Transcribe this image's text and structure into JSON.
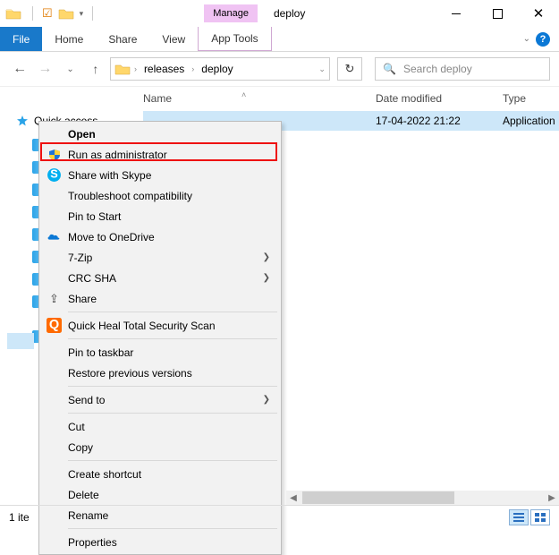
{
  "window": {
    "context_tab": "Manage",
    "title": "deploy",
    "controls": {
      "close": "✕"
    }
  },
  "tabs": {
    "file": "File",
    "home": "Home",
    "share": "Share",
    "view": "View",
    "apptools": "App Tools"
  },
  "help": {
    "caret": "⌄",
    "q": "?"
  },
  "nav": {
    "back": "←",
    "forward": "→",
    "up": "↑",
    "recent_caret": "⌄",
    "refresh": "↻"
  },
  "breadcrumb": {
    "seg1": "releases",
    "seg2": "deploy",
    "sep": "›"
  },
  "search": {
    "placeholder": "Search deploy",
    "icon": "🔍"
  },
  "columns": {
    "name": "Name",
    "date": "Date modified",
    "type": "Type",
    "sort_caret": "˄"
  },
  "navtree": {
    "quick_access": "Quick access"
  },
  "filelist": {
    "rows": [
      {
        "name": "",
        "date": "17-04-2022 21:22",
        "type": "Application"
      }
    ]
  },
  "context_menu": {
    "open": "Open",
    "run_admin": "Run as administrator",
    "skype": "Share with Skype",
    "troubleshoot": "Troubleshoot compatibility",
    "pin_start": "Pin to Start",
    "onedrive": "Move to OneDrive",
    "sevenzip": "7-Zip",
    "crc": "CRC SHA",
    "share": "Share",
    "quickheal": "Quick Heal Total Security Scan",
    "pin_taskbar": "Pin to taskbar",
    "restore_prev": "Restore previous versions",
    "send_to": "Send to",
    "cut": "Cut",
    "copy": "Copy",
    "shortcut": "Create shortcut",
    "delete": "Delete",
    "rename": "Rename",
    "properties": "Properties",
    "arrow": "❯"
  },
  "statusbar": {
    "items": "1 ite"
  }
}
